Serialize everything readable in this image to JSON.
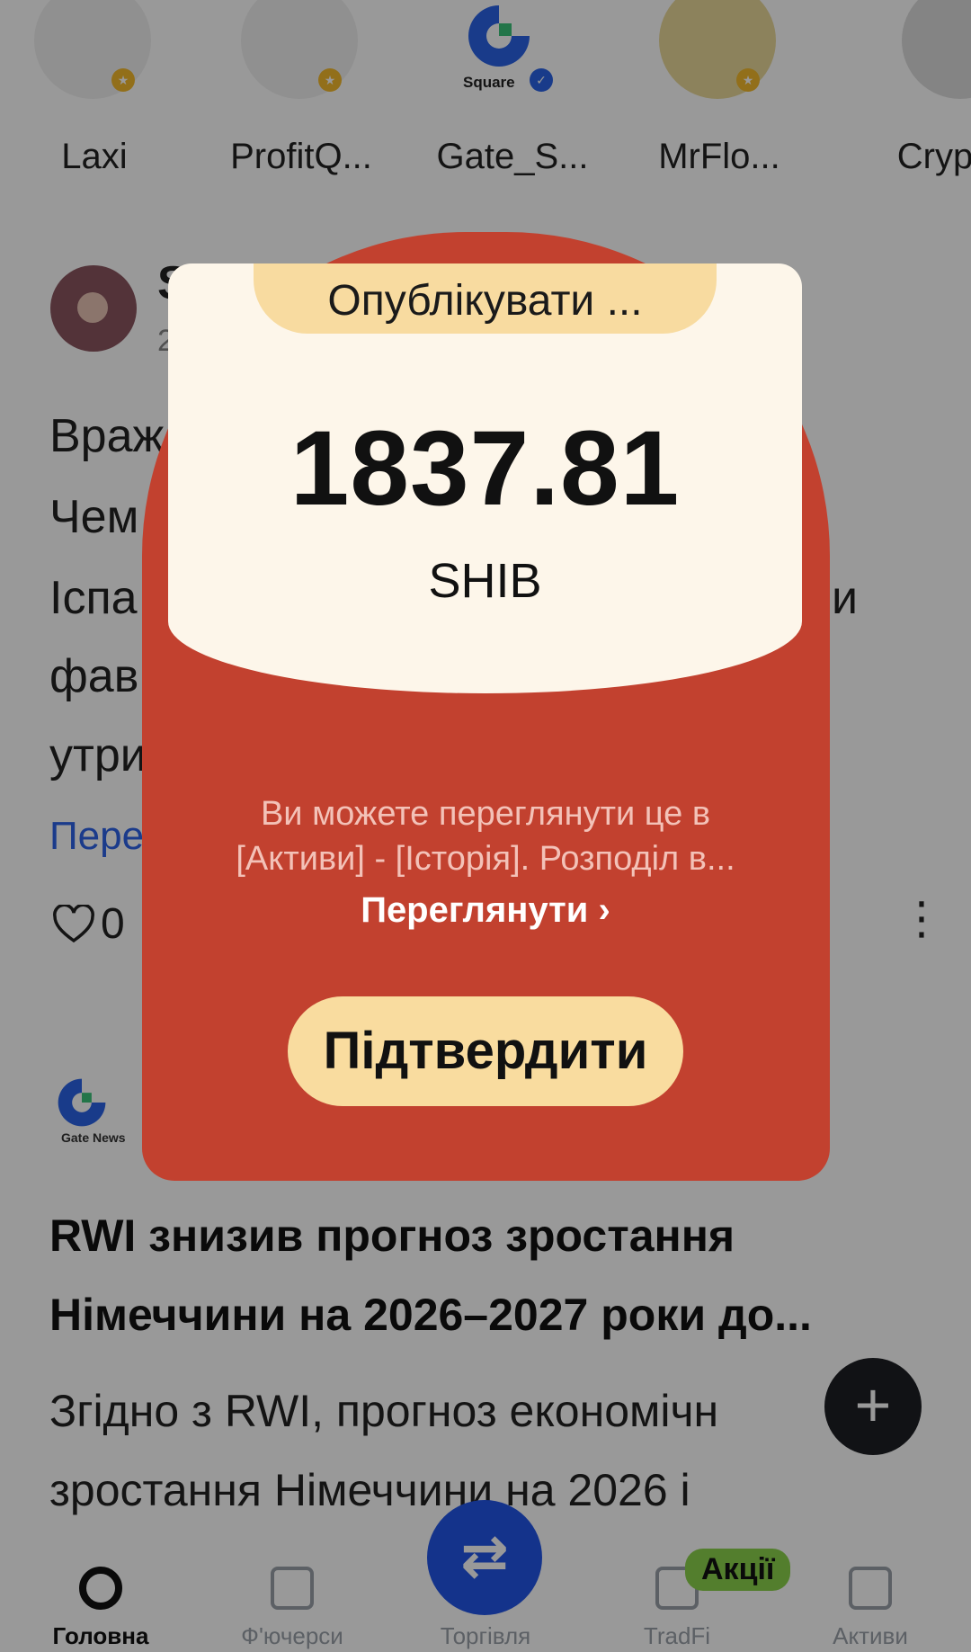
{
  "stories": [
    {
      "name": "Laxi"
    },
    {
      "name": "ProfitQ..."
    },
    {
      "name": "Gate_S...",
      "logo_text": "Square"
    },
    {
      "name": "MrFlo..."
    },
    {
      "name": "Cryp"
    }
  ],
  "post": {
    "author_initial": "S",
    "time_partial": "2",
    "lines": [
      "Враж",
      "Чем",
      "Іспа",
      "фав",
      "утри"
    ],
    "line_tail": "и",
    "more_link": "Пере",
    "like_count": "0"
  },
  "news": {
    "source": "Gate News",
    "headline_1": "RWI знизив прогноз зростання",
    "headline_2": "Німеччини на 2026–2027 роки до...",
    "body_1": "Згідно з RWI, прогноз економічн",
    "body_2": "зростання Німеччини на 2026 і"
  },
  "tabs": [
    {
      "label": "Головна"
    },
    {
      "label": "Ф'ючерси"
    },
    {
      "label": "Торгівля"
    },
    {
      "label": "TradFi"
    },
    {
      "label": "Активи"
    }
  ],
  "promo_badge": "Акції",
  "modal": {
    "publish_label": "Опублікувати ...",
    "amount": "1837.81",
    "currency": "SHIB",
    "info_line_1": "Ви можете переглянути це в",
    "info_line_2": "[Активи] - [Історія]. Розподіл в...",
    "view_label": "Переглянути ›",
    "confirm_label": "Підтвердити"
  },
  "colors": {
    "envelope_red": "#c2412f",
    "card_cream": "#fdf6ea",
    "button_gold": "#f9dc9f",
    "link_blue": "#2e63e8",
    "trade_blue": "#2255e8",
    "promo_green": "#8ad24b"
  }
}
